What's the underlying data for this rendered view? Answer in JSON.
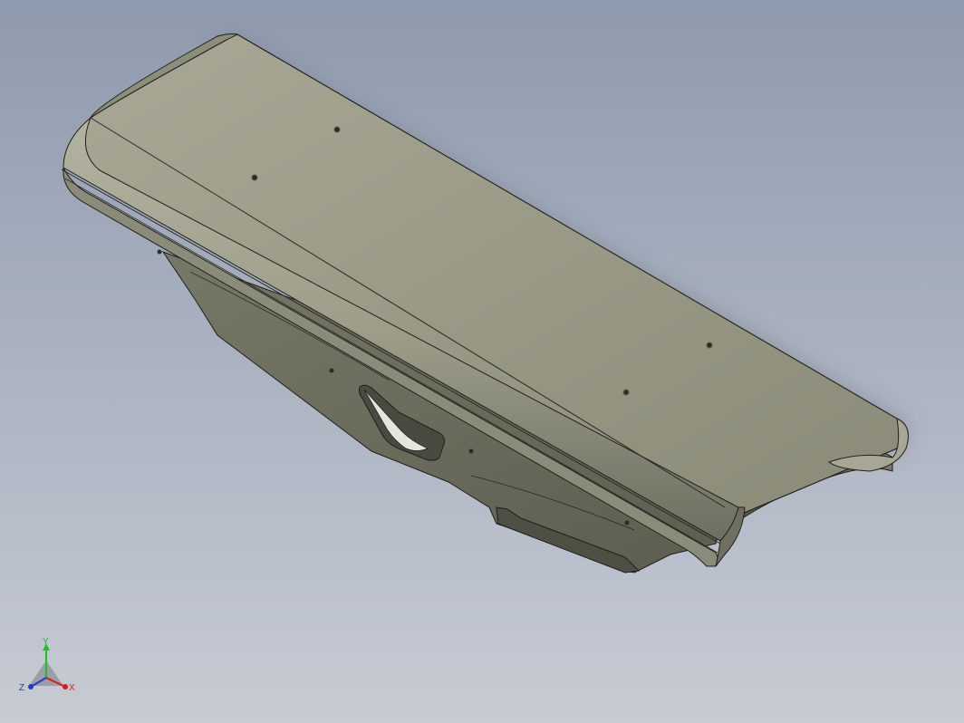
{
  "viewport": {
    "background_top": "#8e9aad",
    "background_bottom": "#c5c9d3",
    "part_color": "#9a9a88",
    "part_shadow": "#5f6152",
    "edge_color": "#1e1f1a"
  },
  "triad": {
    "x_label": "X",
    "y_label": "Y",
    "z_label": "Z",
    "x_color": "#d21e1e",
    "y_color": "#1fbf2a",
    "z_color": "#1e3dd2"
  }
}
